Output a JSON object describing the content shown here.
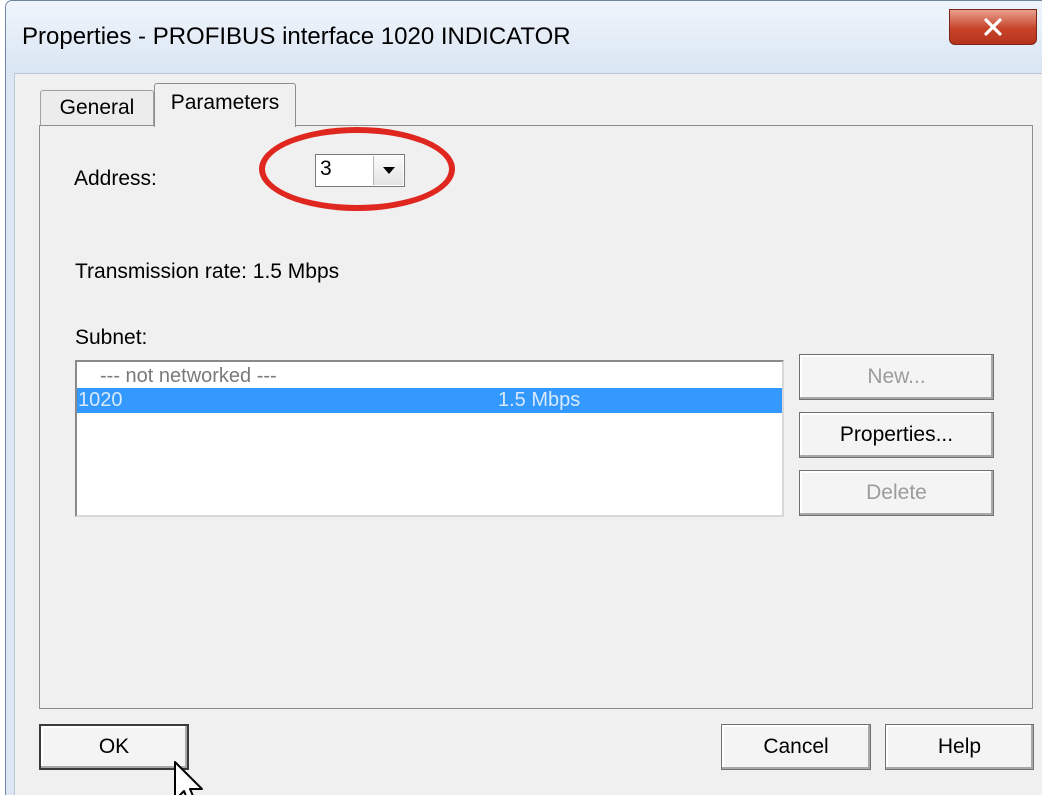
{
  "window": {
    "title": "Properties - PROFIBUS interface  1020 INDICATOR",
    "close_icon": "close-icon"
  },
  "tabs": [
    {
      "label": "General",
      "selected": false
    },
    {
      "label": "Parameters",
      "selected": true
    }
  ],
  "address": {
    "label": "Address:",
    "value": "3"
  },
  "transmission": {
    "label": "Transmission rate: 1.5 Mbps"
  },
  "subnet": {
    "label": "Subnet:",
    "items": [
      {
        "name": "--- not networked ---",
        "rate": ""
      },
      {
        "name": "1020",
        "rate": "1.5 Mbps",
        "selected": true
      }
    ]
  },
  "side_buttons": {
    "new_label": "New...",
    "properties_label": "Properties...",
    "delete_label": "Delete"
  },
  "footer": {
    "ok_label": "OK",
    "cancel_label": "Cancel",
    "help_label": "Help"
  },
  "colors": {
    "selection": "#3399ff",
    "highlight_ellipse": "#e0271f",
    "close_button": "#c7432a"
  }
}
